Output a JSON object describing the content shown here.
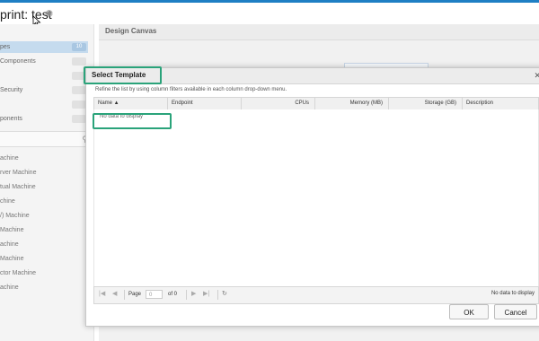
{
  "title": "print: test",
  "left_panel": {
    "categories": [
      {
        "label": "pes",
        "count": "10"
      },
      {
        "label": "Components",
        "count": ""
      },
      {
        "label": "",
        "count": ""
      },
      {
        "label": "Security",
        "count": ""
      },
      {
        "label": "",
        "count": ""
      },
      {
        "label": "ponents",
        "count": ""
      }
    ],
    "components": [
      "achine",
      "rver Machine",
      "tual Machine",
      "chine",
      "/) Machine",
      "Machine",
      "achine",
      "Machine",
      "ctor Machine",
      "achine"
    ]
  },
  "canvas": {
    "header": "Design Canvas"
  },
  "dialog": {
    "title": "Select Template",
    "hint": "Refine the list by using column filters available in each column drop-down menu.",
    "columns": [
      "Name ▲",
      "Endpoint",
      "CPUs",
      "Memory (MB)",
      "Storage (GB)",
      "Description"
    ],
    "empty_text": "No data to display",
    "pager": {
      "page_label": "Page",
      "page_value": "0",
      "of_label": "of 0",
      "status": "No data to display"
    },
    "ok_label": "OK",
    "cancel_label": "Cancel"
  },
  "colors": {
    "accent": "#1f7fc4",
    "highlight": "#2aa37a",
    "selected": "#c5dbee"
  }
}
